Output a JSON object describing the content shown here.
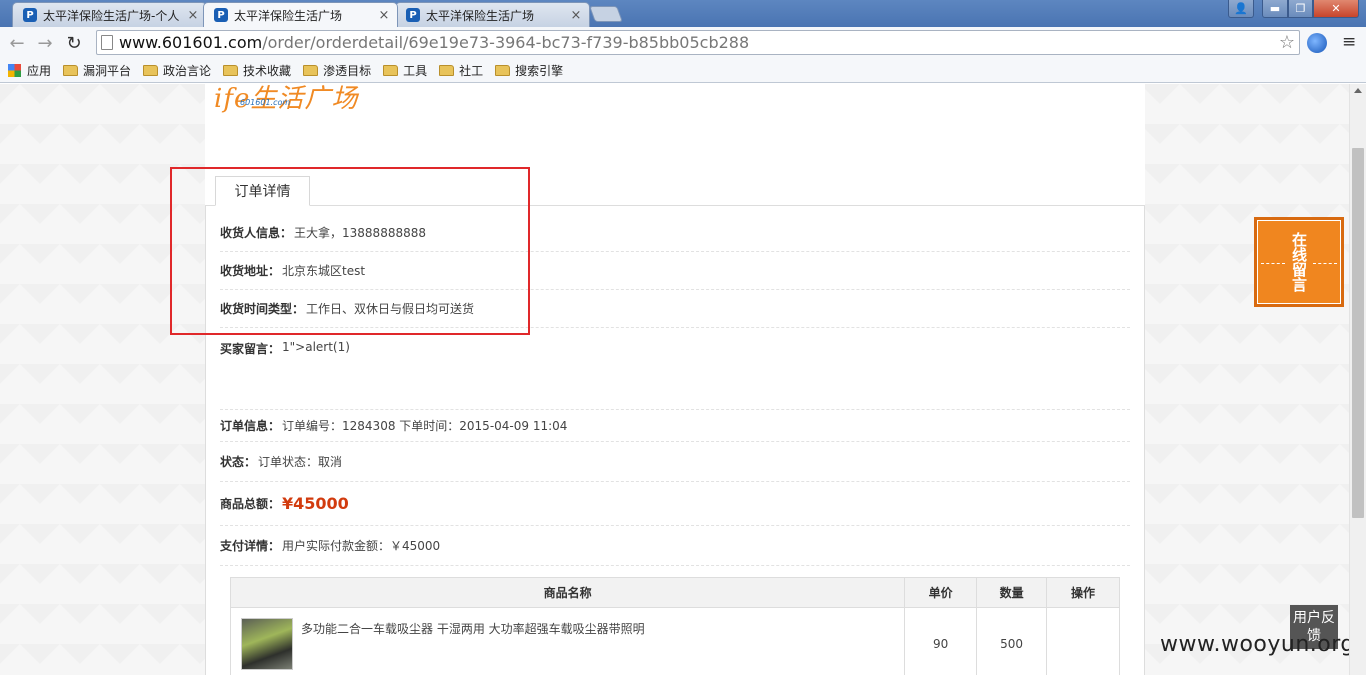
{
  "browser": {
    "tabs": [
      {
        "title": "太平洋保险生活广场-个人",
        "favicon": "P"
      },
      {
        "title": "太平洋保险生活广场",
        "favicon": "P"
      },
      {
        "title": "太平洋保险生活广场",
        "favicon": "P"
      }
    ],
    "close_glyph": "×",
    "url_host": "www.601601.com",
    "url_path": "/order/orderdetail/69e19e73-3964-bc73-f739-b85bb05cb288",
    "bookmarks": [
      "应用",
      "漏洞平台",
      "政治言论",
      "技术收藏",
      "渗透目标",
      "工具",
      "社工",
      "搜索引擎"
    ],
    "nav_glyphs": {
      "back": "←",
      "forward": "→",
      "reload": "↻",
      "star": "☆",
      "menu": "≡",
      "minimize": "▬",
      "maximize": "❐",
      "close": "✕",
      "user": "👤"
    }
  },
  "logo": {
    "text": "ife生活广场",
    "domain": "601601.com"
  },
  "order": {
    "tab_label": "订单详情",
    "receiver_label": "收货人信息：",
    "receiver_value": "王大拿，13888888888",
    "address_label": "收货地址：",
    "address_value": "北京东城区test",
    "delivery_label": "收货时间类型：",
    "delivery_value": "工作日、双休日与假日均可送货",
    "buyer_msg_label": "买家留言：",
    "buyer_msg_value": "1\">alert(1)",
    "info_label": "订单信息：",
    "info_value": "订单编号：1284308 下单时间：2015-04-09 11:04",
    "status_label": "状态：",
    "status_value": "订单状态：取消",
    "total_label": "商品总额：",
    "total_value": "¥45000",
    "payment_label": "支付详情：",
    "payment_value": "用户实际付款金额：￥45000"
  },
  "table": {
    "headers": [
      "商品名称",
      "单价",
      "数量",
      "操作"
    ],
    "rows": [
      {
        "name": "多功能二合一车载吸尘器 干湿两用 大功率超强车载吸尘器带照明",
        "price": "90",
        "qty": "500",
        "op": ""
      }
    ]
  },
  "widgets": {
    "online_msg": "在线留言",
    "feedback": "用户反馈",
    "watermark": "www.wooyun.org"
  }
}
